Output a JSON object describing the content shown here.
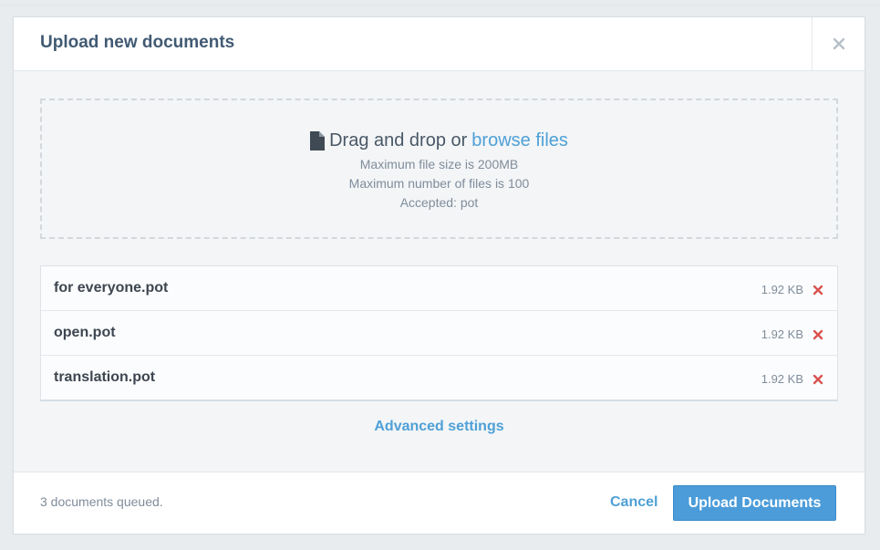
{
  "modal": {
    "title": "Upload new documents",
    "close_icon": "close-icon"
  },
  "dropzone": {
    "icon": "file-icon",
    "prefix": "Drag and drop or",
    "browse_link": "browse files",
    "max_size": "Maximum file size is 200MB",
    "max_files": "Maximum number of files is 100",
    "accepted": "Accepted: pot"
  },
  "files": [
    {
      "name": "for everyone.pot",
      "size": "1.92 KB"
    },
    {
      "name": "open.pot",
      "size": "1.92 KB"
    },
    {
      "name": "translation.pot",
      "size": "1.92 KB"
    }
  ],
  "advanced_settings": "Advanced settings",
  "footer": {
    "status": "3 documents queued.",
    "cancel": "Cancel",
    "upload": "Upload Documents"
  },
  "colors": {
    "accent": "#4b9cd9",
    "link": "#4fa0d6",
    "remove": "#d9534f",
    "title": "#415a73"
  }
}
